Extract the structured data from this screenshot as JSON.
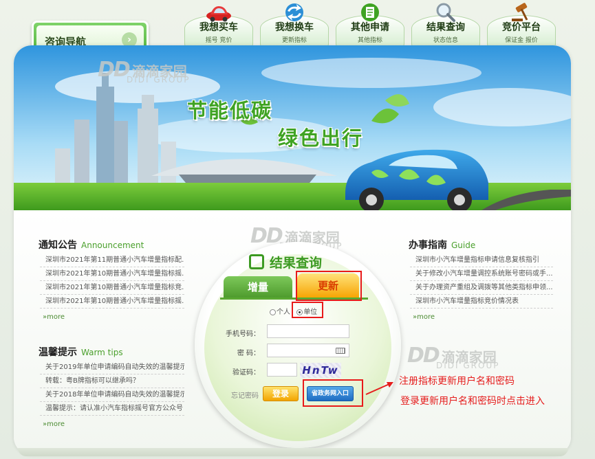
{
  "nav": {
    "guide_label": "咨询导航",
    "guide_arrow": "›",
    "tabs": [
      {
        "label": "我想买车",
        "sub": "摇号  竞价"
      },
      {
        "label": "我想换车",
        "sub": "更新指标"
      },
      {
        "label": "其他申请",
        "sub": "其他指标"
      },
      {
        "label": "结果查询",
        "sub": "状态信息"
      },
      {
        "label": "竞价平台",
        "sub": "保证金  报价"
      }
    ]
  },
  "banner": {
    "slogan_line1": "节能低碳",
    "slogan_line2": "绿色出行"
  },
  "watermark": {
    "logo": "DD",
    "cn": "滴滴家园",
    "en": "DIDI GROUP"
  },
  "notice": {
    "title": "通知公告",
    "title_en": "Announcement",
    "items": [
      "深圳市2021年第11期普通小汽车增量指标配...",
      "深圳市2021年第10期普通小汽车增量指标摇...",
      "深圳市2021年第10期普通小汽车增量指标竞...",
      "深圳市2021年第10期普通小汽车增量指标摇..."
    ],
    "more": "more"
  },
  "tips": {
    "title": "温馨提示",
    "title_en": "Warm tips",
    "items": [
      "关于2019年单位申请编码自动失效的温馨提示",
      "转载：粤B牌指标可以继承吗？",
      "关于2018年单位申请编码自动失效的温馨提示",
      "温馨提示：请认准小汽车指标摇号官方公众号"
    ],
    "more": "more"
  },
  "guide": {
    "title": "办事指南",
    "title_en": "Guide",
    "items": [
      "深圳市小汽车增量指标申请信息复核指引",
      "关于修改小汽车增量调控系统账号密码或手...",
      "关于办理资产重组及调拨等其他类指标申领...",
      "深圳市小汽车增量指标竞价情况表"
    ],
    "more": "more"
  },
  "query": {
    "title": "结果查询",
    "tab_add": "增量",
    "tab_update": "更新",
    "radio_personal": "个人",
    "radio_company": "单位",
    "phone_label": "手机号码：",
    "password_label": "密 码：",
    "captcha_label": "验证码：",
    "captcha_text": "HnTw",
    "forgot": "忘记密码",
    "login": "登录",
    "portal": "省政务网入口"
  },
  "annotation": {
    "line1": "注册指标更新用户名和密码",
    "line2": "登录更新用户名和密码时点击进入"
  },
  "colors": {
    "brand_green": "#4aa02c",
    "highlight_red": "#e81a1a",
    "update_orange": "#f6a300",
    "portal_blue": "#1e6cc2"
  }
}
